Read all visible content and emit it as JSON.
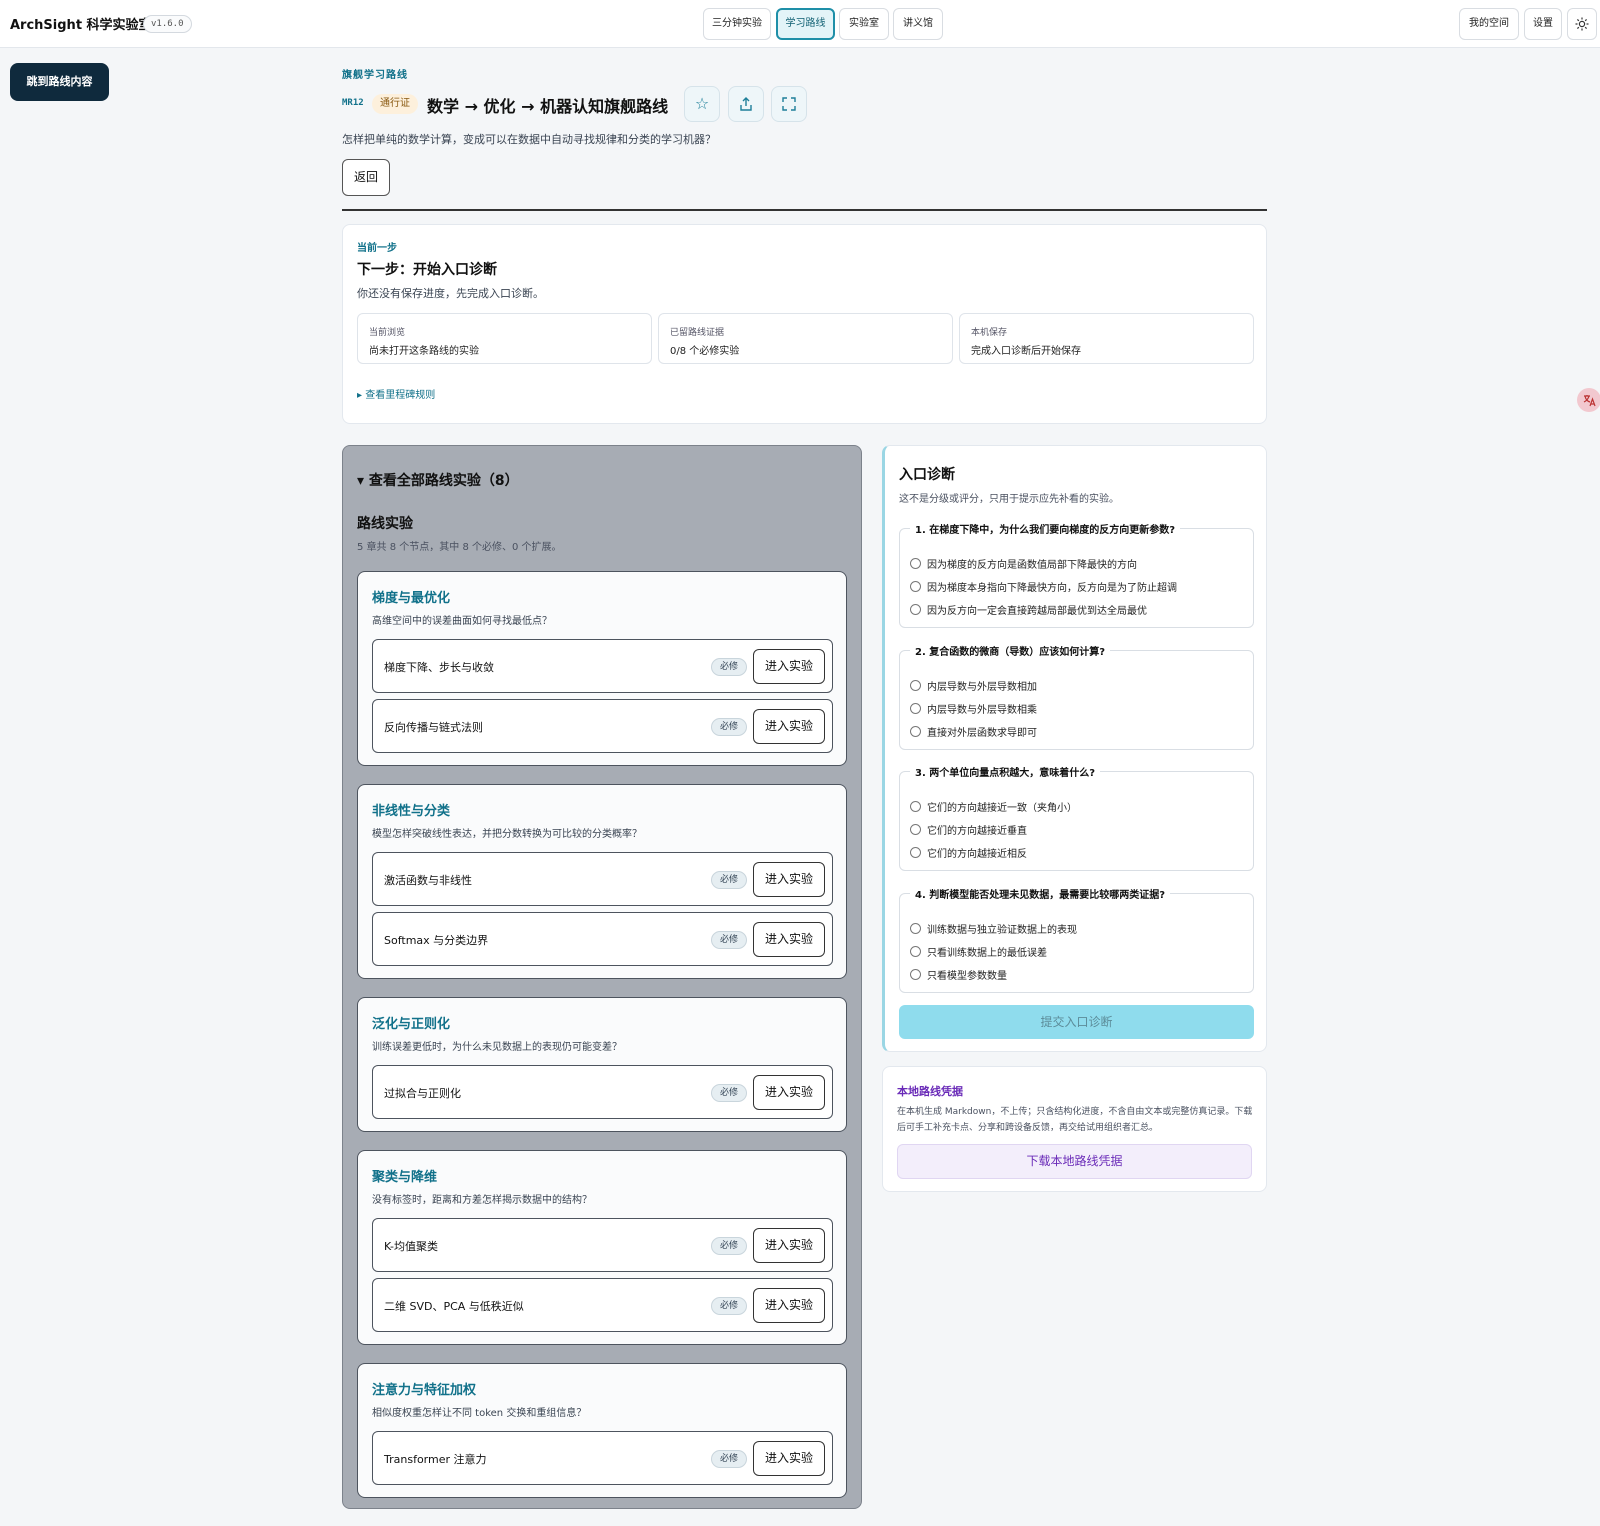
{
  "topbar": {
    "brand": "ArchSight 科学实验室",
    "version": "v1.6.0",
    "nav": [
      {
        "label": "三分钟实验"
      },
      {
        "label": "学习路线"
      },
      {
        "label": "实验室"
      },
      {
        "label": "讲义馆"
      }
    ],
    "my_space": "我的空间",
    "settings": "设置",
    "theme_icon": "sun-icon"
  },
  "skip_link": "跳到路线内容",
  "header": {
    "eyebrow": "旗舰学习路线",
    "code": "MR12",
    "pass_badge": "通行证",
    "title": "数学 → 优化 → 机器认知旗舰路线",
    "subtitle": "怎样把单纯的数学计算，变成可以在数据中自动寻找规律和分类的学习机器？",
    "back": "返回",
    "icons": [
      "star-icon",
      "share-icon",
      "fullscreen-icon"
    ]
  },
  "current_step": {
    "eyebrow": "当前一步",
    "title": "下一步：开始入口诊断",
    "desc": "你还没有保存进度，先完成入口诊断。",
    "stats": [
      {
        "label": "当前浏览",
        "value": "尚未打开这条路线的实验"
      },
      {
        "label": "已留路线证据",
        "value": "0/8 个必修实验"
      },
      {
        "label": "本机保存",
        "value": "完成入口诊断后开始保存"
      }
    ],
    "milestone_link": "▸ 查看里程碑规则"
  },
  "route": {
    "summary": "▾ 查看全部路线实验（8）",
    "title": "路线实验",
    "desc": "5 章共 8 个节点，其中 8 个必修、0 个扩展。",
    "required_label": "必修",
    "enter_label": "进入实验",
    "chapters": [
      {
        "title": "梯度与最优化",
        "desc": "高维空间中的误差曲面如何寻找最低点？",
        "experiments": [
          {
            "name": "梯度下降、步长与收敛"
          },
          {
            "name": "反向传播与链式法则"
          }
        ]
      },
      {
        "title": "非线性与分类",
        "desc": "模型怎样突破线性表达，并把分数转换为可比较的分类概率？",
        "experiments": [
          {
            "name": "激活函数与非线性"
          },
          {
            "name": "Softmax 与分类边界"
          }
        ]
      },
      {
        "title": "泛化与正则化",
        "desc": "训练误差更低时，为什么未见数据上的表现仍可能变差？",
        "experiments": [
          {
            "name": "过拟合与正则化"
          }
        ]
      },
      {
        "title": "聚类与降维",
        "desc": "没有标签时，距离和方差怎样揭示数据中的结构？",
        "experiments": [
          {
            "name": "K-均值聚类"
          },
          {
            "name": "二维 SVD、PCA 与低秩近似"
          }
        ]
      },
      {
        "title": "注意力与特征加权",
        "desc": "相似度权重怎样让不同 token 交换和重组信息？",
        "experiments": [
          {
            "name": "Transformer 注意力"
          }
        ]
      }
    ]
  },
  "diagnostic": {
    "title": "入口诊断",
    "desc": "这不是分级或评分，只用于提示应先补看的实验。",
    "questions": [
      {
        "q": "1. 在梯度下降中，为什么我们要向梯度的反方向更新参数?",
        "options": [
          "因为梯度的反方向是函数值局部下降最快的方向",
          "因为梯度本身指向下降最快方向，反方向是为了防止超调",
          "因为反方向一定会直接跨越局部最优到达全局最优"
        ]
      },
      {
        "q": "2. 复合函数的微商（导数）应该如何计算?",
        "options": [
          "内层导数与外层导数相加",
          "内层导数与外层导数相乘",
          "直接对外层函数求导即可"
        ]
      },
      {
        "q": "3. 两个单位向量点积越大，意味着什么?",
        "options": [
          "它们的方向越接近一致（夹角小）",
          "它们的方向越接近垂直",
          "它们的方向越接近相反"
        ]
      },
      {
        "q": "4. 判断模型能否处理未见数据，最需要比较哪两类证据?",
        "options": [
          "训练数据与独立验证数据上的表现",
          "只看训练数据上的最低误差",
          "只看模型参数数量"
        ]
      }
    ],
    "submit": "提交入口诊断"
  },
  "local_proof": {
    "title": "本地路线凭据",
    "desc": "在本机生成 Markdown，不上传；只含结构化进度，不含自由文本或完整仿真记录。下载后可手工补充卡点、分享和跨设备反馈，再交给试用组织者汇总。",
    "button": "下载本地路线凭据"
  },
  "colors": {
    "accent": "#11718a",
    "purple": "#6a2bb8",
    "panel": "#a7acb4"
  }
}
